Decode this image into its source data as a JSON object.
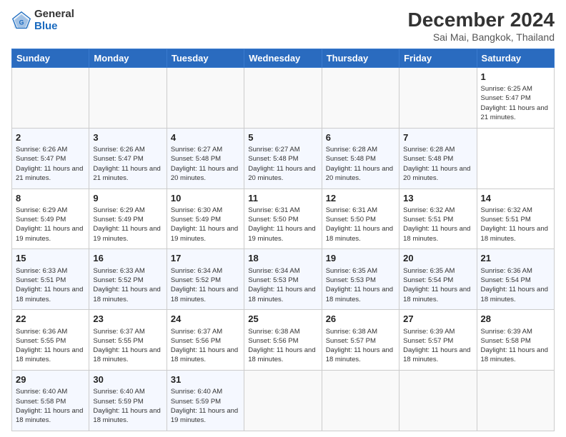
{
  "header": {
    "logo": {
      "general": "General",
      "blue": "Blue"
    },
    "title": "December 2024",
    "subtitle": "Sai Mai, Bangkok, Thailand"
  },
  "calendar": {
    "headers": [
      "Sunday",
      "Monday",
      "Tuesday",
      "Wednesday",
      "Thursday",
      "Friday",
      "Saturday"
    ],
    "weeks": [
      [
        null,
        null,
        null,
        null,
        null,
        null,
        {
          "day": "1",
          "sunrise": "Sunrise: 6:25 AM",
          "sunset": "Sunset: 5:47 PM",
          "daylight": "Daylight: 11 hours and 21 minutes."
        }
      ],
      [
        {
          "day": "2",
          "sunrise": "Sunrise: 6:26 AM",
          "sunset": "Sunset: 5:47 PM",
          "daylight": "Daylight: 11 hours and 21 minutes."
        },
        {
          "day": "3",
          "sunrise": "Sunrise: 6:26 AM",
          "sunset": "Sunset: 5:47 PM",
          "daylight": "Daylight: 11 hours and 21 minutes."
        },
        {
          "day": "4",
          "sunrise": "Sunrise: 6:27 AM",
          "sunset": "Sunset: 5:48 PM",
          "daylight": "Daylight: 11 hours and 20 minutes."
        },
        {
          "day": "5",
          "sunrise": "Sunrise: 6:27 AM",
          "sunset": "Sunset: 5:48 PM",
          "daylight": "Daylight: 11 hours and 20 minutes."
        },
        {
          "day": "6",
          "sunrise": "Sunrise: 6:28 AM",
          "sunset": "Sunset: 5:48 PM",
          "daylight": "Daylight: 11 hours and 20 minutes."
        },
        {
          "day": "7",
          "sunrise": "Sunrise: 6:28 AM",
          "sunset": "Sunset: 5:48 PM",
          "daylight": "Daylight: 11 hours and 20 minutes."
        }
      ],
      [
        {
          "day": "8",
          "sunrise": "Sunrise: 6:29 AM",
          "sunset": "Sunset: 5:49 PM",
          "daylight": "Daylight: 11 hours and 19 minutes."
        },
        {
          "day": "9",
          "sunrise": "Sunrise: 6:29 AM",
          "sunset": "Sunset: 5:49 PM",
          "daylight": "Daylight: 11 hours and 19 minutes."
        },
        {
          "day": "10",
          "sunrise": "Sunrise: 6:30 AM",
          "sunset": "Sunset: 5:49 PM",
          "daylight": "Daylight: 11 hours and 19 minutes."
        },
        {
          "day": "11",
          "sunrise": "Sunrise: 6:31 AM",
          "sunset": "Sunset: 5:50 PM",
          "daylight": "Daylight: 11 hours and 19 minutes."
        },
        {
          "day": "12",
          "sunrise": "Sunrise: 6:31 AM",
          "sunset": "Sunset: 5:50 PM",
          "daylight": "Daylight: 11 hours and 18 minutes."
        },
        {
          "day": "13",
          "sunrise": "Sunrise: 6:32 AM",
          "sunset": "Sunset: 5:51 PM",
          "daylight": "Daylight: 11 hours and 18 minutes."
        },
        {
          "day": "14",
          "sunrise": "Sunrise: 6:32 AM",
          "sunset": "Sunset: 5:51 PM",
          "daylight": "Daylight: 11 hours and 18 minutes."
        }
      ],
      [
        {
          "day": "15",
          "sunrise": "Sunrise: 6:33 AM",
          "sunset": "Sunset: 5:51 PM",
          "daylight": "Daylight: 11 hours and 18 minutes."
        },
        {
          "day": "16",
          "sunrise": "Sunrise: 6:33 AM",
          "sunset": "Sunset: 5:52 PM",
          "daylight": "Daylight: 11 hours and 18 minutes."
        },
        {
          "day": "17",
          "sunrise": "Sunrise: 6:34 AM",
          "sunset": "Sunset: 5:52 PM",
          "daylight": "Daylight: 11 hours and 18 minutes."
        },
        {
          "day": "18",
          "sunrise": "Sunrise: 6:34 AM",
          "sunset": "Sunset: 5:53 PM",
          "daylight": "Daylight: 11 hours and 18 minutes."
        },
        {
          "day": "19",
          "sunrise": "Sunrise: 6:35 AM",
          "sunset": "Sunset: 5:53 PM",
          "daylight": "Daylight: 11 hours and 18 minutes."
        },
        {
          "day": "20",
          "sunrise": "Sunrise: 6:35 AM",
          "sunset": "Sunset: 5:54 PM",
          "daylight": "Daylight: 11 hours and 18 minutes."
        },
        {
          "day": "21",
          "sunrise": "Sunrise: 6:36 AM",
          "sunset": "Sunset: 5:54 PM",
          "daylight": "Daylight: 11 hours and 18 minutes."
        }
      ],
      [
        {
          "day": "22",
          "sunrise": "Sunrise: 6:36 AM",
          "sunset": "Sunset: 5:55 PM",
          "daylight": "Daylight: 11 hours and 18 minutes."
        },
        {
          "day": "23",
          "sunrise": "Sunrise: 6:37 AM",
          "sunset": "Sunset: 5:55 PM",
          "daylight": "Daylight: 11 hours and 18 minutes."
        },
        {
          "day": "24",
          "sunrise": "Sunrise: 6:37 AM",
          "sunset": "Sunset: 5:56 PM",
          "daylight": "Daylight: 11 hours and 18 minutes."
        },
        {
          "day": "25",
          "sunrise": "Sunrise: 6:38 AM",
          "sunset": "Sunset: 5:56 PM",
          "daylight": "Daylight: 11 hours and 18 minutes."
        },
        {
          "day": "26",
          "sunrise": "Sunrise: 6:38 AM",
          "sunset": "Sunset: 5:57 PM",
          "daylight": "Daylight: 11 hours and 18 minutes."
        },
        {
          "day": "27",
          "sunrise": "Sunrise: 6:39 AM",
          "sunset": "Sunset: 5:57 PM",
          "daylight": "Daylight: 11 hours and 18 minutes."
        },
        {
          "day": "28",
          "sunrise": "Sunrise: 6:39 AM",
          "sunset": "Sunset: 5:58 PM",
          "daylight": "Daylight: 11 hours and 18 minutes."
        }
      ],
      [
        {
          "day": "29",
          "sunrise": "Sunrise: 6:40 AM",
          "sunset": "Sunset: 5:58 PM",
          "daylight": "Daylight: 11 hours and 18 minutes."
        },
        {
          "day": "30",
          "sunrise": "Sunrise: 6:40 AM",
          "sunset": "Sunset: 5:59 PM",
          "daylight": "Daylight: 11 hours and 18 minutes."
        },
        {
          "day": "31",
          "sunrise": "Sunrise: 6:40 AM",
          "sunset": "Sunset: 5:59 PM",
          "daylight": "Daylight: 11 hours and 19 minutes."
        },
        null,
        null,
        null,
        null
      ]
    ]
  }
}
